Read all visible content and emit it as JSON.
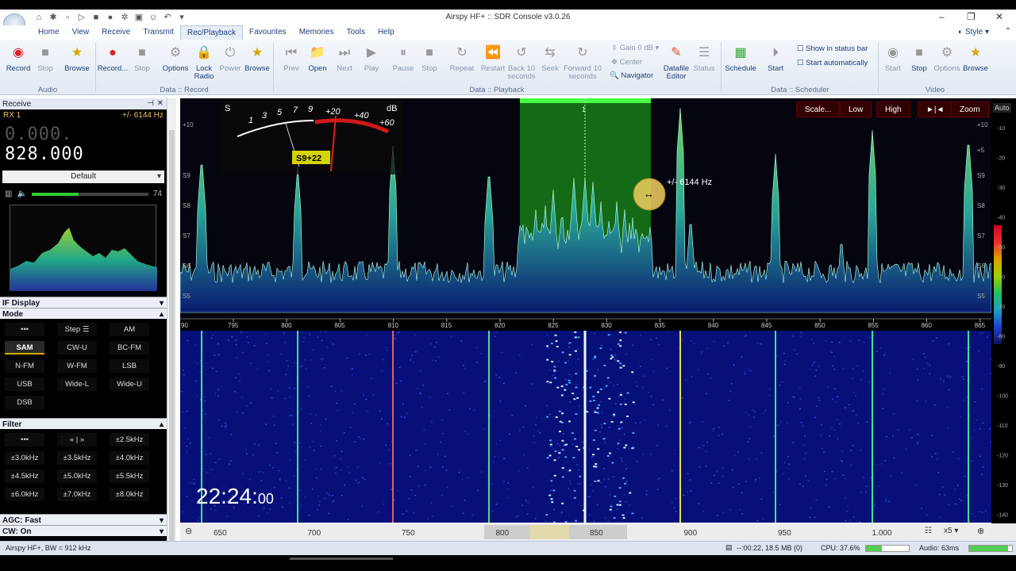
{
  "window": {
    "title": "Airspy HF+ :: SDR Console v3.0.26"
  },
  "menu": {
    "items": [
      "Home",
      "View",
      "Receive",
      "Transmit",
      "Rec/Playback",
      "Favourites",
      "Memories",
      "Tools",
      "Help"
    ],
    "style": "Style"
  },
  "ribbon": {
    "audio": {
      "record": "Record",
      "stop": "Stop",
      "browse": "Browse",
      "group": "Audio"
    },
    "data_record": {
      "record": "Record...",
      "stop": "Stop",
      "options": "Options",
      "lock_radio": "Lock Radio",
      "power": "Power",
      "browse": "Browse",
      "group": "Data :: Record"
    },
    "data_playback": {
      "prev": "Prev",
      "open": "Open",
      "next": "Next",
      "play": "Play",
      "pause": "Pause",
      "stop": "Stop",
      "repeat": "Repeat",
      "restart": "Restart",
      "back10": "Back 10 seconds",
      "seek": "Seek",
      "fwd10": "Forward 10 seconds",
      "gain": "Gain 0 dB",
      "center": "Center",
      "navigator": "Navigator",
      "datafile_editor": "Datafile Editor",
      "status": "Status",
      "group": "Data :: Playback"
    },
    "scheduler": {
      "schedule": "Schedule",
      "start": "Start",
      "show_status": "Show in status bar",
      "start_auto": "Start automatically",
      "group": "Data :: Scheduler"
    },
    "video": {
      "start": "Start",
      "stop": "Stop",
      "options": "Options",
      "browse": "Browse",
      "group": "Video"
    }
  },
  "receive": {
    "panel_title": "Receive",
    "rx": "RX 1",
    "bandwidth": "+/- 6144 Hz",
    "freq_dim": "0.000.",
    "freq_main": "828.000",
    "preset": "Default",
    "volume": "74"
  },
  "sections": {
    "if_display": "IF Display",
    "mode": "Mode",
    "filter": "Filter",
    "agc": "AGC: Fast",
    "cw": "CW: On"
  },
  "modes": [
    "•••",
    "Step ☰",
    "AM",
    "SAM",
    "CW-U",
    "BC-FM",
    "N-FM",
    "W-FM",
    "LSB",
    "USB",
    "Wide-L",
    "Wide-U",
    "DSB"
  ],
  "selected_mode": "SAM",
  "filters": [
    "•••",
    "« | »",
    "±2.5kHz",
    "±3.0kHz",
    "±3.5kHz",
    "±4.0kHz",
    "±4.5kHz",
    "±5.0kHz",
    "±5.5kHz",
    "±6.0kHz",
    "±7.0kHz",
    "±8.0kHz"
  ],
  "spectrum": {
    "signal_badge": "S9+22",
    "bw_label": "+/-  6144 Hz",
    "channel_label": "1",
    "meter_s": "S",
    "meter_db": "dB",
    "meter_ticks": [
      "1",
      "3",
      "5",
      "7",
      "9",
      "+20",
      "+40",
      "+60"
    ],
    "buttons": [
      "Scale...",
      "Low",
      "High",
      "►|◄",
      "Zoom"
    ],
    "auto": "Auto",
    "left_scale": [
      "+10",
      "S9",
      "S8",
      "S7",
      "S6",
      "S5"
    ],
    "right_scale": [
      "+10",
      "+5",
      "S9",
      "S8",
      "S7",
      "S6",
      "S5"
    ]
  },
  "freq_axis": [
    "795",
    "800",
    "805",
    "810",
    "815",
    "820",
    "825",
    "830",
    "835",
    "840",
    "845",
    "850",
    "855",
    "860",
    "865"
  ],
  "clock": {
    "time": "22:24:",
    "seconds": "00"
  },
  "time_axis": {
    "labels": [
      "650",
      "700",
      "750",
      "800",
      "850",
      "900",
      "950",
      "1.000"
    ],
    "zoom": "x5"
  },
  "wf_scale": [
    "-10",
    "-20",
    "-30",
    "-40",
    "-50",
    "-60",
    "-70",
    "-80",
    "-90",
    "-100",
    "-110",
    "-120",
    "-130",
    "-140"
  ],
  "status": {
    "left": "Airspy HF+, BW = 912 kHz",
    "rec": "--:00:22, 18.5 MB (0)",
    "cpu": "CPU: 37.6%",
    "audio": "Audio: 63ms"
  },
  "colors": {
    "accent": "#1e3f7a",
    "passband": "#22c022",
    "spectrum_trace": "#40c090",
    "waterfall": "#0a1aa0"
  }
}
